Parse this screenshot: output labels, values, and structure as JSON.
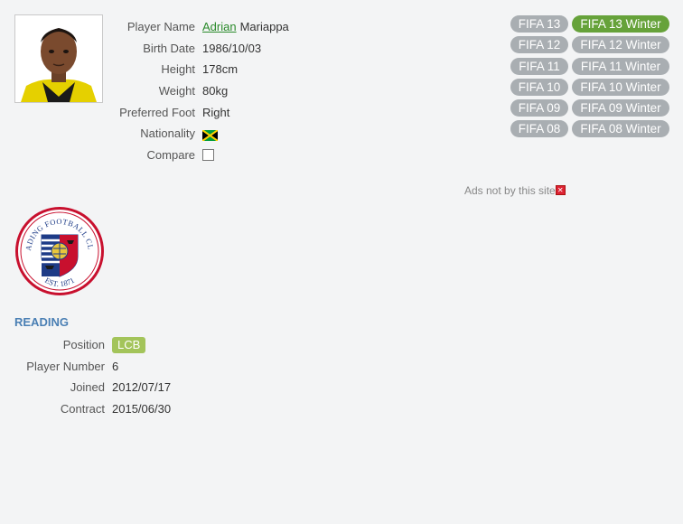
{
  "player": {
    "first_name": "Adrian",
    "last_name": "Mariappa",
    "fields": [
      {
        "label": "Player Name"
      },
      {
        "label": "Birth Date",
        "value": "1986/10/03"
      },
      {
        "label": "Height",
        "value": "178cm"
      },
      {
        "label": "Weight",
        "value": "80kg"
      },
      {
        "label": "Preferred Foot",
        "value": "Right"
      },
      {
        "label": "Nationality",
        "flag_icon": "jamaica-flag-icon"
      },
      {
        "label": "Compare",
        "checkbox_checked": false
      }
    ]
  },
  "versions": [
    {
      "edition": "FIFA 13",
      "winter": "FIFA 13 Winter",
      "active": "winter"
    },
    {
      "edition": "FIFA 12",
      "winter": "FIFA 12 Winter"
    },
    {
      "edition": "FIFA 11",
      "winter": "FIFA 11 Winter"
    },
    {
      "edition": "FIFA 10",
      "winter": "FIFA 10 Winter"
    },
    {
      "edition": "FIFA 09",
      "winter": "FIFA 09 Winter"
    },
    {
      "edition": "FIFA 08",
      "winter": "FIFA 08 Winter"
    }
  ],
  "ads": {
    "text": "Ads not by this site",
    "close_icon": "close-icon"
  },
  "club": {
    "name": "READING",
    "crest_text_top": "READING FOOTBALL CLUB",
    "crest_text_bottom": "EST. 1871",
    "fields": [
      {
        "label": "Position",
        "value": "LCB"
      },
      {
        "label": "Player Number",
        "value": "6"
      },
      {
        "label": "Joined",
        "value": "2012/07/17"
      },
      {
        "label": "Contract",
        "value": "2015/06/30"
      }
    ]
  },
  "colors": {
    "active_pill": "#66a23a",
    "inactive_pill": "#a9aeb2",
    "club_name": "#4a7fb4",
    "position_badge": "#a3c45a",
    "link": "#2a8a2a"
  }
}
